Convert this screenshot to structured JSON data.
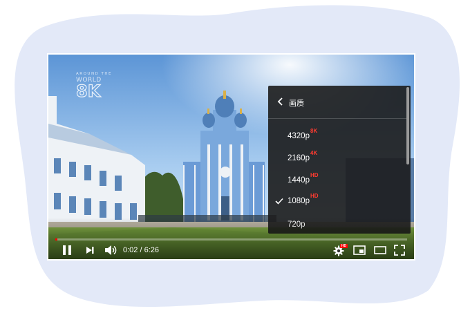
{
  "watermark": {
    "line1": "AROUND THE",
    "line2": "WORLD",
    "line3": "8K"
  },
  "quality_menu": {
    "title": "画质",
    "items": [
      {
        "label": "4320p",
        "badge": "8K",
        "selected": false
      },
      {
        "label": "2160p",
        "badge": "4K",
        "selected": false
      },
      {
        "label": "1440p",
        "badge": "HD",
        "selected": false
      },
      {
        "label": "1080p",
        "badge": "HD",
        "selected": true
      },
      {
        "label": "720p",
        "badge": "",
        "selected": false
      }
    ]
  },
  "player": {
    "time": "0:02 / 6:26",
    "progress_fraction": 0.005,
    "settings_badge": "HD"
  },
  "colors": {
    "accent": "#ff0000",
    "badge": "#ff3b30",
    "blob": "#e3e9f8"
  },
  "icons": {
    "play": "play-icon",
    "next": "next-icon",
    "volume": "volume-icon",
    "settings": "gear-icon",
    "miniplayer": "miniplayer-icon",
    "theater": "theater-icon",
    "fullscreen": "fullscreen-icon"
  }
}
